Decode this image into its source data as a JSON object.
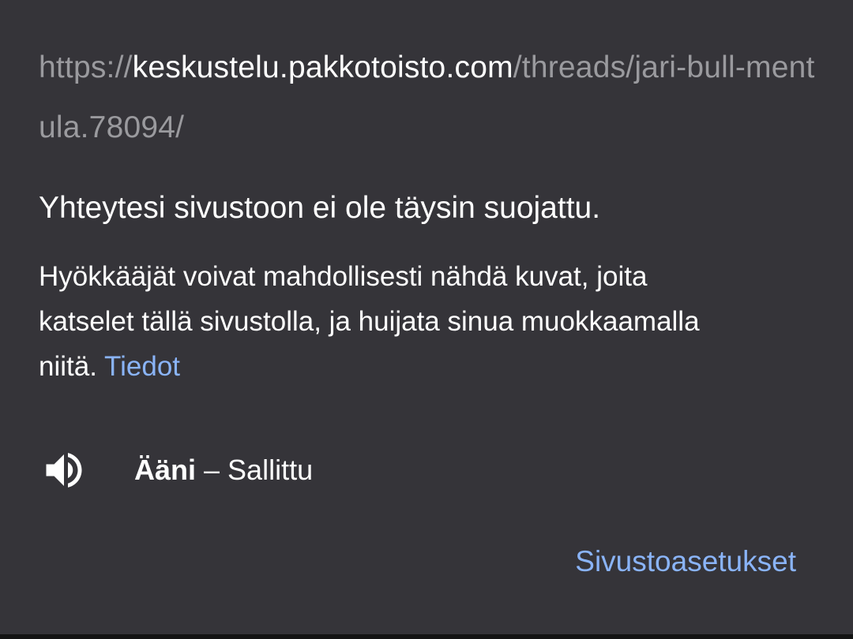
{
  "url": {
    "scheme": "https://",
    "host": "keskustelu.pakkotoisto.com",
    "path": "/threads/jari-bull-mentula.78094/"
  },
  "security": {
    "heading": "Yhteytesi sivustoon ei ole täysin suojattu.",
    "description": "Hyökkääjät voivat mahdollisesti nähdä kuvat, joita katselet tällä sivustolla, ja huijata sinua muokkaamalla niitä.",
    "details_link": "Tiedot"
  },
  "permissions": [
    {
      "icon": "speaker-icon",
      "name": "Ääni",
      "separator": " – ",
      "status": "Sallittu"
    }
  ],
  "actions": {
    "site_settings": "Sivustoasetukset"
  },
  "colors": {
    "background": "#353439",
    "text": "#ffffff",
    "dim_text": "#9a9a9e",
    "link": "#8ab4f8"
  }
}
